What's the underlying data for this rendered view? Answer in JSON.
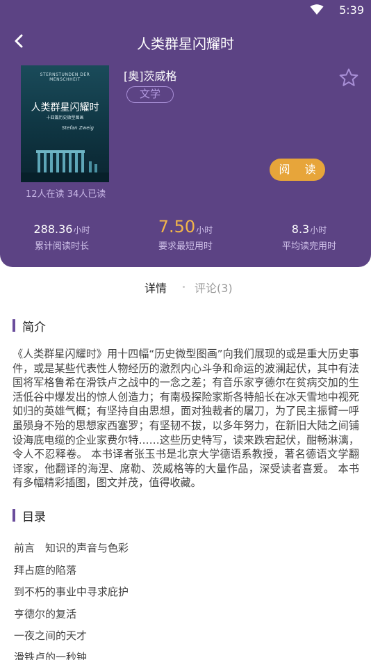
{
  "status_bar": {
    "time": "5:39",
    "wifi_icon": "wifi-icon"
  },
  "header": {
    "back_icon": "back-chevron-icon",
    "title": "人类群星闪耀时",
    "colors": {
      "header_bg": "#5c4384",
      "accent": "#e7a53a"
    }
  },
  "book": {
    "cover": {
      "top_line": "STERNSTUNDEN DER MENSCHHEIT",
      "title": "人类群星闪耀时",
      "subtitle": "十四篇历史微型图画",
      "signature": "Stefan Zweig"
    },
    "read_counts": "12人在读 34人已读",
    "author": "[奥]茨威格",
    "tag": "文学",
    "favorite_icon": "star-outline-icon",
    "read_button": "阅 读"
  },
  "stats": [
    {
      "value": "288.36",
      "unit": "小时",
      "label": "累计阅读时长"
    },
    {
      "value": "7.50",
      "unit": "小时",
      "label": "要求最短用时"
    },
    {
      "value": "8.3",
      "unit": "小时",
      "label": "平均读完用时"
    }
  ],
  "tabs": {
    "details": "详情",
    "comments": "评论(3)"
  },
  "intro": {
    "heading": "简介",
    "text": "《人类群星闪耀时》用十四幅“历史微型图画”向我们展现的或是重大历史事件，或是某些代表性人物经历的激烈内心斗争和命运的波澜起伏，其中有法国将军格鲁希在滑铁卢之战中的一念之差；有音乐家亨德尔在贫病交加的生活低谷中爆发出的惊人创造力；有南极探险家斯各特船长在冰天雪地中视死如归的英雄气概；有坚持自由思想，面对独裁者的屠刀，为了民主振臂一呼虽殒身不殆的思想家西塞罗；有坚韧不拔，以多年努力，在新旧大陆之间铺设海底电缆的企业家费尔特……这些历史特写，读来跌宕起伏，酣畅淋漓，令人不忍释卷。 本书译者张玉书是北京大学德语系教授，著名德语文学翻译家，他翻译的海涅、席勒、茨威格等的大量作品，深受读者喜爱。 本书有多幅精彩插图，图文并茂，值得收藏。"
  },
  "toc": {
    "heading": "目录",
    "items": [
      "前言　知识的声音与色彩",
      "拜占庭的陷落",
      "到不朽的事业中寻求庇护",
      "亨德尔的复活",
      "一夜之间的天才",
      "滑铁卢的一秒钟"
    ]
  }
}
